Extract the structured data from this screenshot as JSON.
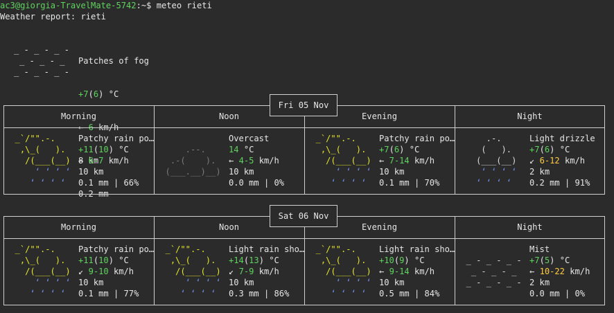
{
  "prompt": {
    "user_host": "ac3@giorgia-TravelMate-5742",
    "path": ":~",
    "symbol": "$",
    "command": " meteo rieti"
  },
  "report_title": "Weather report: rieti",
  "current": {
    "condition": "Patches of fog",
    "temp_main": "+7",
    "temp_feels": "6",
    "temp_unit": "°C",
    "wind_arrow": "←",
    "wind": "6",
    "wind_unit": "km/h",
    "visibility": "8 km",
    "precip": "0.2 mm",
    "art": [
      "_ - _ - _ -",
      "_ - _ - _",
      "_ - _ - _ -"
    ]
  },
  "days": [
    {
      "date": "Fri 05 Nov",
      "periods": [
        {
          "name": "Morning",
          "condition": "Patchy rain po…",
          "icon": "rain-sun-icon",
          "temp_main": "+11",
          "temp_feels": "10",
          "temp_unit": "°C",
          "wind_arrow": "←",
          "wind": "6-7",
          "wind_unit": "km/h",
          "visibility": "10 km",
          "precip": "0.1 mm | 66%"
        },
        {
          "name": "Noon",
          "condition": "Overcast",
          "icon": "cloud-icon",
          "temp_main": "14",
          "temp_feels": "",
          "temp_unit": "°C",
          "wind_arrow": "←",
          "wind": "4-5",
          "wind_unit": "km/h",
          "visibility": "10 km",
          "precip": "0.0 mm | 0%"
        },
        {
          "name": "Evening",
          "condition": "Patchy rain po…",
          "icon": "rain-sun-icon",
          "temp_main": "+7",
          "temp_feels": "6",
          "temp_unit": "°C",
          "wind_arrow": "←",
          "wind": "7-14",
          "wind_unit": "km/h",
          "visibility": "10 km",
          "precip": "0.1 mm | 70%"
        },
        {
          "name": "Night",
          "condition": "Light drizzle",
          "icon": "drizzle-icon",
          "temp_main": "+7",
          "temp_feels": "6",
          "temp_unit": "°C",
          "wind_arrow": "↙",
          "wind": "6-12",
          "wind_unit": "km/h",
          "visibility": "2 km",
          "precip": "0.2 mm | 91%"
        }
      ]
    },
    {
      "date": "Sat 06 Nov",
      "periods": [
        {
          "name": "Morning",
          "condition": "Patchy rain po…",
          "icon": "rain-sun-icon",
          "temp_main": "+11",
          "temp_feels": "10",
          "temp_unit": "°C",
          "wind_arrow": "↙",
          "wind": "9-10",
          "wind_unit": "km/h",
          "visibility": "10 km",
          "precip": "0.1 mm | 77%"
        },
        {
          "name": "Noon",
          "condition": "Light rain sho…",
          "icon": "rain-sun-icon",
          "temp_main": "+14",
          "temp_feels": "13",
          "temp_unit": "°C",
          "wind_arrow": "↙",
          "wind": "7-9",
          "wind_unit": "km/h",
          "visibility": "10 km",
          "precip": "0.3 mm | 86%"
        },
        {
          "name": "Evening",
          "condition": "Light rain sho…",
          "icon": "rain-sun-icon",
          "temp_main": "+10",
          "temp_feels": "9",
          "temp_unit": "°C",
          "wind_arrow": "←",
          "wind": "9-14",
          "wind_unit": "km/h",
          "visibility": "10 km",
          "precip": "0.5 mm | 84%"
        },
        {
          "name": "Night",
          "condition": "Mist",
          "icon": "fog-icon",
          "temp_main": "+7",
          "temp_feels": "5",
          "temp_unit": "°C",
          "wind_arrow": "←",
          "wind": "10-22",
          "wind_unit": "km/h",
          "visibility": "2 km",
          "precip": "0.0 mm | 0%"
        }
      ]
    }
  ]
}
